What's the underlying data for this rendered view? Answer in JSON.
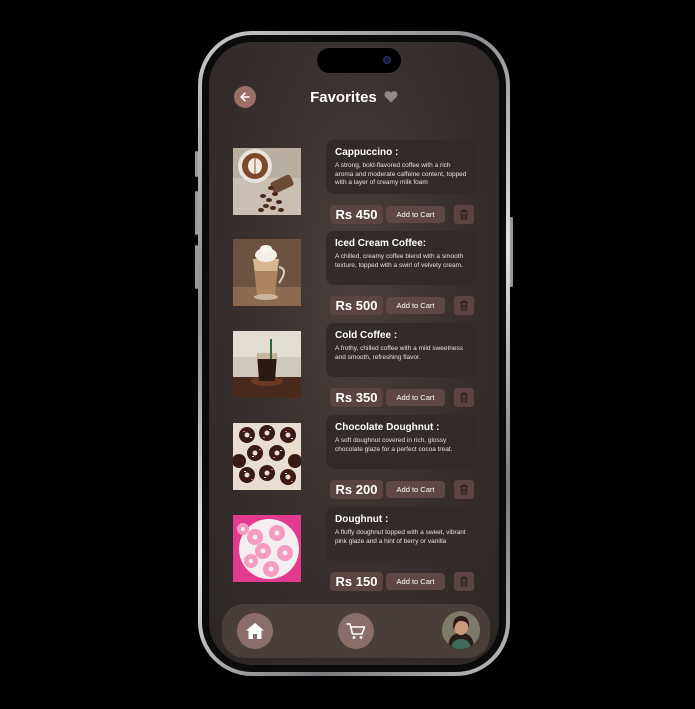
{
  "header": {
    "title": "Favorites"
  },
  "items": [
    {
      "name": "Cappuccino :",
      "desc": "A strong, bold-flavored coffee with a rich aroma and moderate caffeine content, topped with a layer of creamy milk foam",
      "price": "Rs 450",
      "cta": "Add to Cart"
    },
    {
      "name": "Iced Cream Coffee:",
      "desc": "A chilled, creamy coffee blend with a smooth texture, topped with a swirl of velvety cream.",
      "price": "Rs 500",
      "cta": "Add to Cart"
    },
    {
      "name": "Cold Coffee :",
      "desc": "A frothy, chilled coffee with a mild sweetness and smooth, refreshing flavor.",
      "price": "Rs 350",
      "cta": "Add to Cart"
    },
    {
      "name": "Chocolate Doughnut :",
      "desc": "A soft doughnut covered in rich, glossy chocolate glaze for a perfect cocoa treat.",
      "price": "Rs 200",
      "cta": "Add to Cart"
    },
    {
      "name": "Doughnut :",
      "desc": "A fluffy doughnut topped with a sweet, vibrant pink glaze and a hint of berry or vanilla",
      "price": "Rs 150",
      "cta": "Add to Cart"
    }
  ],
  "nav": {
    "items": [
      "home-icon",
      "cart-icon",
      "profile-avatar"
    ]
  },
  "colors": {
    "accent": "#9b6f68",
    "card": "#332b29",
    "button": "#5e4845",
    "nav": "#4a3e3b"
  }
}
